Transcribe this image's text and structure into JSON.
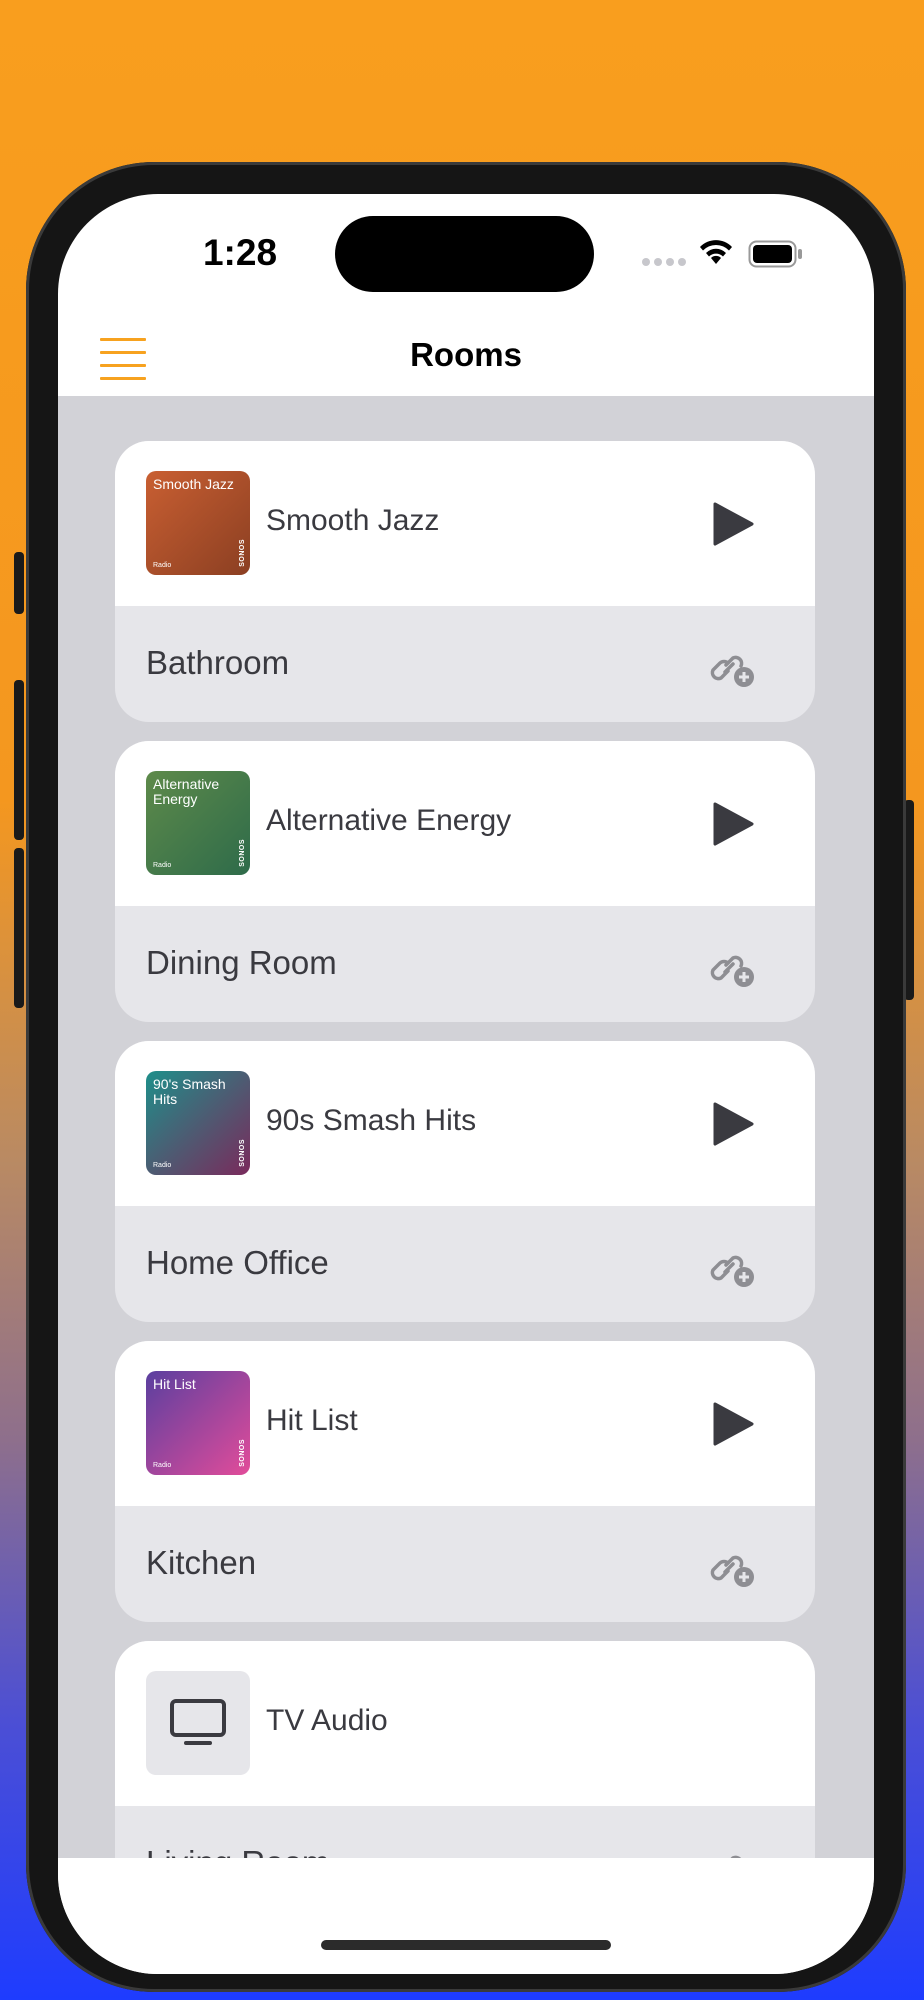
{
  "status_bar": {
    "time": "1:28"
  },
  "nav": {
    "title": "Rooms"
  },
  "rooms": [
    {
      "track": "Smooth Jazz",
      "room": "Bathroom",
      "art_label": "Smooth Jazz",
      "art_radio": "Radio",
      "art_brand": "SONOS",
      "art_colors": [
        "#C95F32",
        "#8B3F22"
      ]
    },
    {
      "track": "Alternative Energy",
      "room": "Dining Room",
      "art_label": "Alternative Energy",
      "art_radio": "Radio",
      "art_brand": "SONOS",
      "art_colors": [
        "#5E8A4A",
        "#2E6B4A"
      ]
    },
    {
      "track": "90s Smash Hits",
      "room": "Home Office",
      "art_label": "90's Smash Hits",
      "art_radio": "Radio",
      "art_brand": "SONOS",
      "art_colors": [
        "#1E8F8A",
        "#7A2A5C"
      ]
    },
    {
      "track": "Hit List",
      "room": "Kitchen",
      "art_label": "Hit List",
      "art_radio": "Radio",
      "art_brand": "SONOS",
      "art_colors": [
        "#E24C9A",
        "#5A3F9F"
      ]
    },
    {
      "track": "TV Audio",
      "room": "Living Room",
      "art_icon": "tv-icon"
    }
  ],
  "colors": {
    "accent": "#F7A21F",
    "list_bg": "#D2D2D7",
    "room_row_bg": "#E6E6EA",
    "text": "#3A3A40"
  }
}
